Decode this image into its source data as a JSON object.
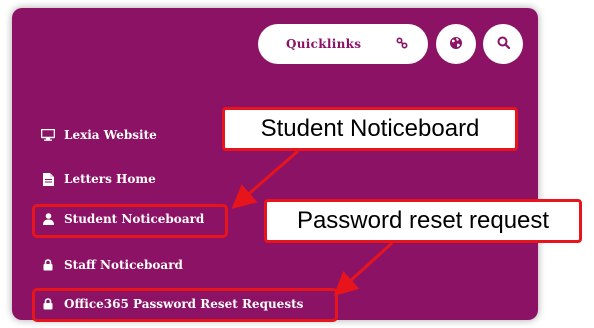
{
  "header": {
    "quicklinks_label": "Quicklinks",
    "link_icon": "link-icon",
    "globe_icon": "globe-icon",
    "search_icon": "search-icon"
  },
  "menu": {
    "items": [
      {
        "label": "Lexia Website",
        "icon": "desktop-icon"
      },
      {
        "label": "Letters Home",
        "icon": "document-icon"
      },
      {
        "label": "Student Noticeboard",
        "icon": "user-icon"
      },
      {
        "label": "Staff Noticeboard",
        "icon": "lock-icon"
      },
      {
        "label": "Office365 Password Reset Requests",
        "icon": "lock-icon"
      }
    ]
  },
  "annotations": {
    "student_callout": "Student Noticeboard",
    "password_callout": "Password reset request"
  },
  "colors": {
    "panel_background": "#8c1266",
    "highlight": "#e8141c",
    "button_background": "#ffffff"
  }
}
